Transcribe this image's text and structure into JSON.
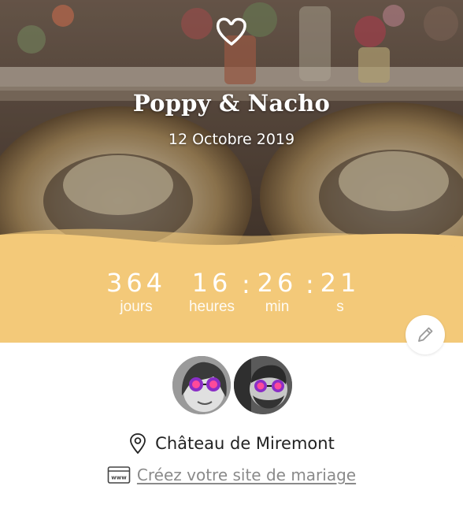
{
  "hero": {
    "title": "Poppy & Nacho",
    "date": "12 Octobre 2019",
    "logo_icon": "heart-icon"
  },
  "countdown": {
    "days": "364",
    "days_label": "jours",
    "hours": "16",
    "hours_label": "heures",
    "minutes": "26",
    "minutes_label": "min",
    "seconds": "21",
    "seconds_label": "s",
    "separator": ":"
  },
  "edit": {
    "icon": "pencil-icon"
  },
  "couple": {
    "avatars": [
      "avatar-bride",
      "avatar-groom"
    ]
  },
  "location": {
    "icon": "map-pin-icon",
    "name": "Château de Miremont"
  },
  "website_link": {
    "icon": "web-browser-icon",
    "label": "Créez votre site de mariage"
  },
  "colors": {
    "accent_yellow": "#f3c979",
    "text_dark": "#222222",
    "link_gray": "#8a8a8a"
  }
}
